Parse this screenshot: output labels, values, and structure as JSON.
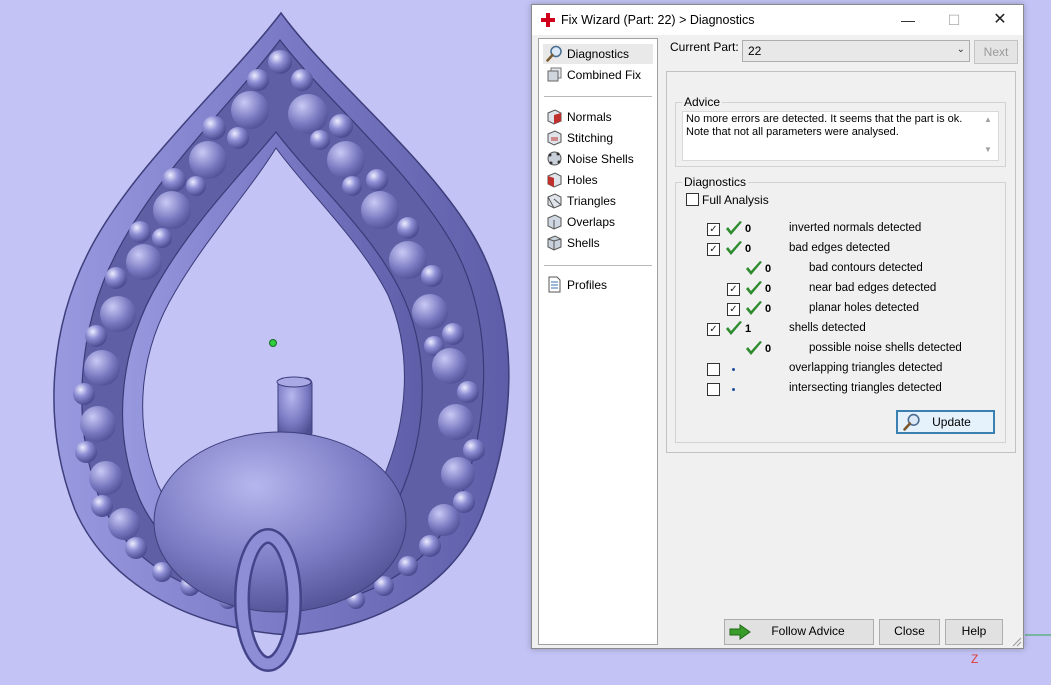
{
  "window": {
    "title": "Fix Wizard (Part: 22) > Diagnostics"
  },
  "nav": {
    "group1": [
      {
        "label": "Diagnostics",
        "icon": "magnifier-icon",
        "active": true
      },
      {
        "label": "Combined Fix",
        "icon": "combined-fix-icon"
      }
    ],
    "group2": [
      {
        "label": "Normals",
        "icon": "normals-cube-icon"
      },
      {
        "label": "Stitching",
        "icon": "stitching-cube-icon"
      },
      {
        "label": "Noise Shells",
        "icon": "noise-shells-icon"
      },
      {
        "label": "Holes",
        "icon": "holes-cube-icon"
      },
      {
        "label": "Triangles",
        "icon": "triangles-cube-icon"
      },
      {
        "label": "Overlaps",
        "icon": "overlaps-cube-icon"
      },
      {
        "label": "Shells",
        "icon": "shells-cube-icon"
      }
    ],
    "group3": [
      {
        "label": "Profiles",
        "icon": "profiles-document-icon"
      }
    ]
  },
  "current_part": {
    "label": "Current Part:",
    "value": "22",
    "next_label": "Next"
  },
  "advice": {
    "title": "Advice",
    "text": "No more errors are detected. It seems that the part is ok.\nNote that not all parameters were analysed."
  },
  "diagnostics": {
    "title": "Diagnostics",
    "full_analysis_label": "Full Analysis",
    "full_analysis_checked": false,
    "rows": [
      {
        "checkbox": true,
        "checked": true,
        "status": "ok",
        "count": "0",
        "label": "inverted normals detected",
        "indent": 0
      },
      {
        "checkbox": true,
        "checked": true,
        "status": "ok",
        "count": "0",
        "label": "bad edges detected",
        "indent": 0
      },
      {
        "checkbox": false,
        "checked": false,
        "status": "ok",
        "count": "0",
        "label": "bad contours detected",
        "indent": 1
      },
      {
        "checkbox": true,
        "checked": true,
        "status": "ok",
        "count": "0",
        "label": "near bad edges detected",
        "indent": 1
      },
      {
        "checkbox": true,
        "checked": true,
        "status": "ok",
        "count": "0",
        "label": "planar holes detected",
        "indent": 1
      },
      {
        "checkbox": true,
        "checked": true,
        "status": "ok",
        "count": "1",
        "label": "shells detected",
        "indent": 0
      },
      {
        "checkbox": false,
        "checked": false,
        "status": "ok",
        "count": "0",
        "label": "possible noise shells detected",
        "indent": 1
      },
      {
        "checkbox": true,
        "checked": false,
        "status": "pending",
        "count": "",
        "label": "overlapping triangles detected",
        "indent": 0
      },
      {
        "checkbox": true,
        "checked": false,
        "status": "pending",
        "count": "",
        "label": "intersecting triangles detected",
        "indent": 0
      }
    ],
    "update_label": "Update"
  },
  "buttons": {
    "follow_advice": "Follow Advice",
    "close": "Close",
    "help": "Help"
  },
  "viewport": {
    "axis_label": "Z"
  },
  "colors": {
    "viewport_bg": "#c3c3f5",
    "model": "#7d7dc8",
    "tick": "#2e8b2e",
    "arrow": "#3a9c2a",
    "title_cross": "#d0021b"
  }
}
